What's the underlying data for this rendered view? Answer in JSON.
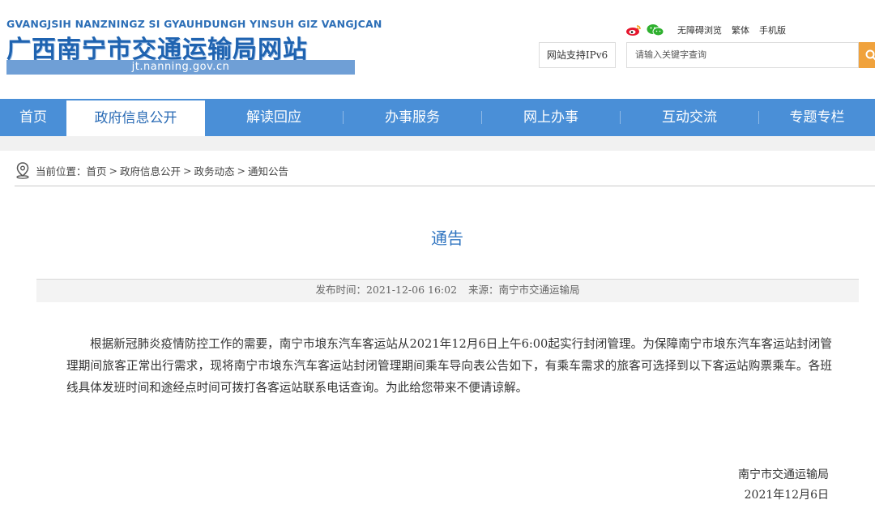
{
  "header": {
    "logo_pinyin": "GVANGJSIH NANZNINGZ SI GYAUHDUNGH YINSUH GIZ VANGJCAN",
    "logo_title": "广西南宁市交通运输局网站",
    "logo_url": "jt.nanning.gov.cn",
    "top_links": [
      "无障碍浏览",
      "繁体",
      "手机版"
    ],
    "social_icons": [
      "weibo-icon",
      "wechat-icon"
    ],
    "ipv6_label": "网站支持IPv6",
    "search_placeholder": "请输入关键字查询"
  },
  "nav": {
    "items": [
      {
        "label": "首页"
      },
      {
        "label": "政府信息公开"
      },
      {
        "label": "解读回应"
      },
      {
        "label": "办事服务"
      },
      {
        "label": "网上办事"
      },
      {
        "label": "互动交流"
      },
      {
        "label": "专题专栏"
      }
    ],
    "active_index": 1
  },
  "breadcrumb": {
    "prefix": "当前位置：",
    "items": [
      "首页",
      "政府信息公开",
      "政务动态",
      "通知公告"
    ],
    "separator": ">"
  },
  "article": {
    "title": "通告",
    "publish_label": "发布时间：",
    "publish_time": "2021-12-06 16:02",
    "source_label": "来源：",
    "source": "南宁市交通运输局",
    "body": "根据新冠肺炎疫情防控工作的需要，南宁市埌东汽车客运站从2021年12月6日上午6:00起实行封闭管理。为保障南宁市埌东汽车客运站封闭管理期间旅客正常出行需求，现将南宁市埌东汽车客运站封闭管理期间乘车导向表公告如下，有乘车需求的旅客可选择到以下客运站购票乘车。各班线具体发班时间和途经点时间可拨打各客运站联系电话查询。为此给您带来不便请谅解。",
    "signature": "南宁市交通运输局",
    "date": "2021年12月6日"
  },
  "colors": {
    "nav_bg": "#4a8fd7",
    "title_blue": "#2f74c0",
    "search_button": "#f0a23c"
  }
}
